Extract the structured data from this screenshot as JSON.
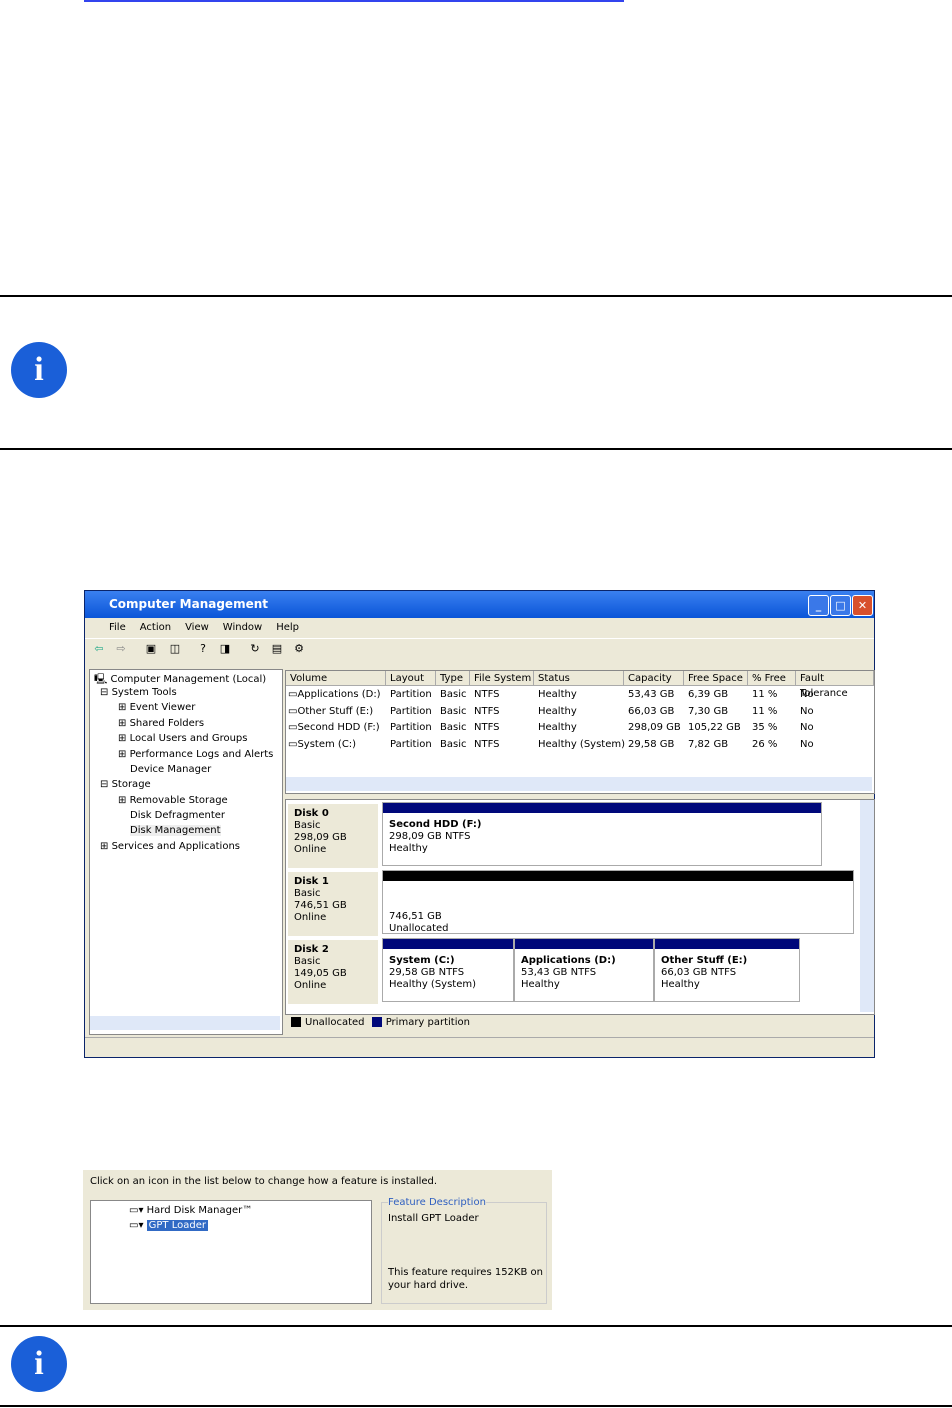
{
  "window": {
    "title": "Computer Management",
    "menu": [
      "File",
      "Action",
      "View",
      "Window",
      "Help"
    ],
    "tree": [
      "Computer Management (Local)",
      "System Tools",
      "Event Viewer",
      "Shared Folders",
      "Local Users and Groups",
      "Performance Logs and Alerts",
      "Device Manager",
      "Storage",
      "Removable Storage",
      "Disk Defragmenter",
      "Disk Management",
      "Services and Applications"
    ],
    "columns": [
      "Volume",
      "Layout",
      "Type",
      "File System",
      "Status",
      "Capacity",
      "Free Space",
      "% Free",
      "Fault Tolerance"
    ],
    "rows": [
      [
        "Applications (D:)",
        "Partition",
        "Basic",
        "NTFS",
        "Healthy",
        "53,43 GB",
        "6,39 GB",
        "11 %",
        "No"
      ],
      [
        "Other Stuff (E:)",
        "Partition",
        "Basic",
        "NTFS",
        "Healthy",
        "66,03 GB",
        "7,30 GB",
        "11 %",
        "No"
      ],
      [
        "Second HDD (F:)",
        "Partition",
        "Basic",
        "NTFS",
        "Healthy",
        "298,09 GB",
        "105,22 GB",
        "35 %",
        "No"
      ],
      [
        "System (C:)",
        "Partition",
        "Basic",
        "NTFS",
        "Healthy (System)",
        "29,58 GB",
        "7,82 GB",
        "26 %",
        "No"
      ]
    ],
    "disks": [
      {
        "name": "Disk 0",
        "type": "Basic",
        "size": "298,09 GB",
        "state": "Online",
        "parts": [
          {
            "name": "Second HDD  (F:)",
            "size": "298,09 GB NTFS",
            "status": "Healthy"
          }
        ]
      },
      {
        "name": "Disk 1",
        "type": "Basic",
        "size": "746,51 GB",
        "state": "Online",
        "parts": [
          {
            "name": "",
            "size": "746,51 GB",
            "status": "Unallocated"
          }
        ]
      },
      {
        "name": "Disk 2",
        "type": "Basic",
        "size": "149,05 GB",
        "state": "Online",
        "parts": [
          {
            "name": "System  (C:)",
            "size": "29,58 GB NTFS",
            "status": "Healthy (System)"
          },
          {
            "name": "Applications  (D:)",
            "size": "53,43 GB NTFS",
            "status": "Healthy"
          },
          {
            "name": "Other Stuff  (E:)",
            "size": "66,03 GB NTFS",
            "status": "Healthy"
          }
        ]
      }
    ],
    "legend": [
      "Unallocated",
      "Primary partition"
    ]
  },
  "installer": {
    "instruction": "Click on an icon in the list below to change how a feature is installed.",
    "features": [
      "Hard Disk Manager™",
      "GPT Loader"
    ],
    "desc_title": "Feature Description",
    "desc": "Install GPT Loader",
    "req1": "This feature requires 152KB on",
    "req2": "your hard drive."
  },
  "colors": {
    "accent": "#1a5fd8",
    "primary_partition": "#00087a"
  }
}
